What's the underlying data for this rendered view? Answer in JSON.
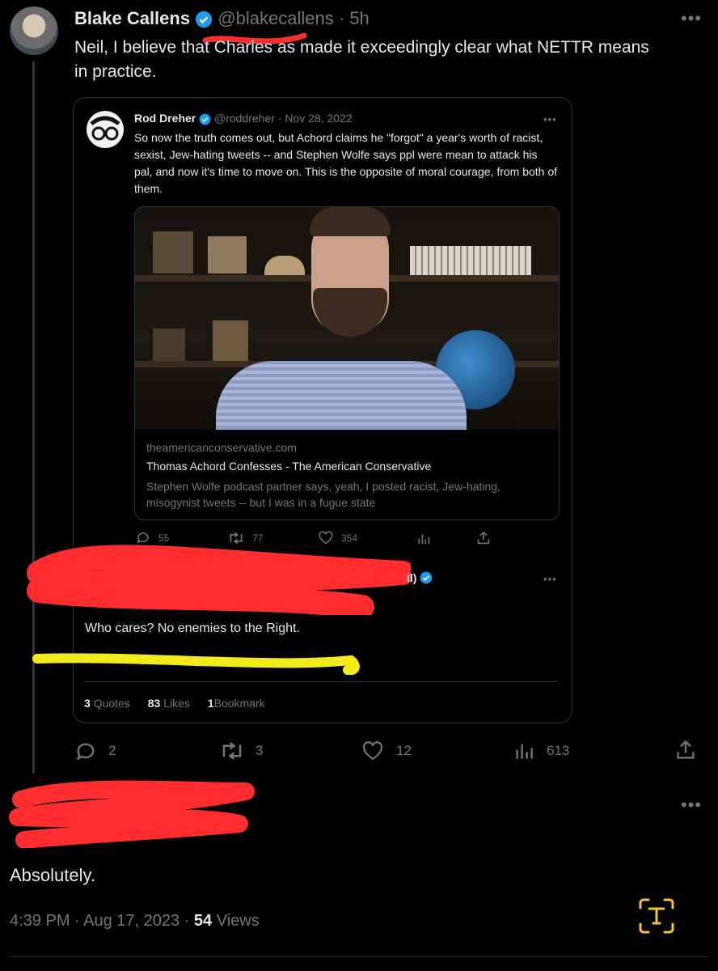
{
  "main_tweet": {
    "name": "Blake Callens",
    "handle": "@blakecallens",
    "time": "· 5h",
    "text_line1": "Neil, I believe that Charles as made it exceedingly clear what NETTR means",
    "text_line2": "in practice."
  },
  "quoted_tweet": {
    "inner": {
      "name": "Rod Dreher",
      "handle": "@roddreher · Nov 28, 2022",
      "text": "So now the truth comes out, but Achord claims he \"forgot\" a year's worth of racist, sexist, Jew-hating tweets -- and Stephen Wolfe says ppl were mean to attack his pal, and now it's time to move on. This is the opposite of moral courage, from both of them.",
      "link": {
        "domain": "theamericanconservative.com",
        "title": "Thomas Achord Confesses - The American Conservative",
        "description": "Stephen Wolfe podcast partner says, yeah, I posted racist, Jew-hating, misogynist tweets -- but I was in a fugue state"
      },
      "stats": {
        "replies": "55",
        "retweets": "77",
        "likes": "354"
      }
    },
    "text": "Who cares? No enemies to the Right.",
    "footer": {
      "quotes_num": "3",
      "quotes_label": "Quotes",
      "likes_num": "83",
      "likes_label": "Likes",
      "bookmark_num": "1",
      "bookmark_label": "Bookmark"
    }
  },
  "main_actions": {
    "replies": "2",
    "retweets": "3",
    "likes": "12",
    "views": "613"
  },
  "reply": {
    "text": "Absolutely.",
    "meta_prefix": "4:39 PM · Aug 17, 2023 · ",
    "views_num": "54",
    "views_label": "Views"
  },
  "colors": {
    "verified": "#1d9bf0",
    "scribble_red": "#ff2d2d",
    "scribble_yellow": "#f2ea1a",
    "accent_gold": "#f7c32e"
  },
  "icons": [
    "more-icon",
    "verified-icon",
    "reply-icon",
    "retweet-icon",
    "like-icon",
    "views-icon",
    "share-icon",
    "text-scan-icon"
  ]
}
